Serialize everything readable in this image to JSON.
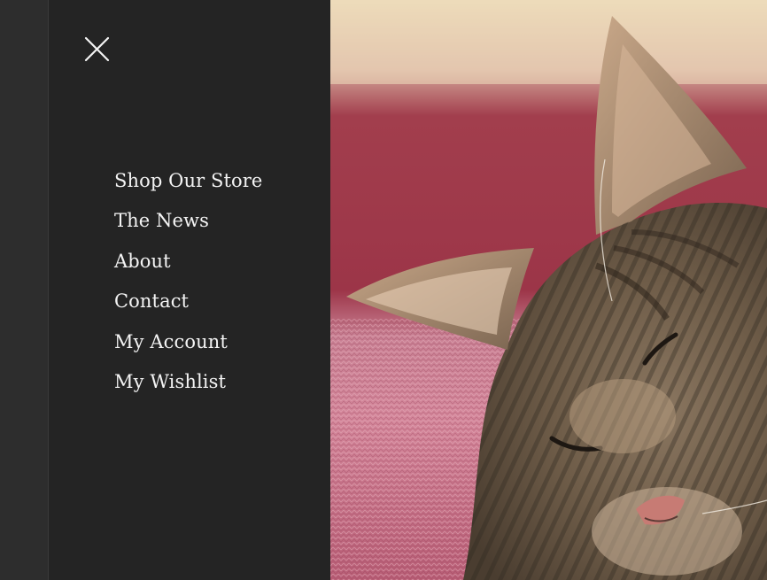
{
  "menu": {
    "close_icon": "close-x-icon",
    "items": [
      {
        "label": "Shop Our Store"
      },
      {
        "label": "The News"
      },
      {
        "label": "About"
      },
      {
        "label": "Contact"
      },
      {
        "label": "My Account"
      },
      {
        "label": "My Wishlist"
      }
    ]
  },
  "colors": {
    "drawer_bg": "#242424",
    "page_bg": "#2d2d2d",
    "menu_text": "#f4f4f4"
  }
}
